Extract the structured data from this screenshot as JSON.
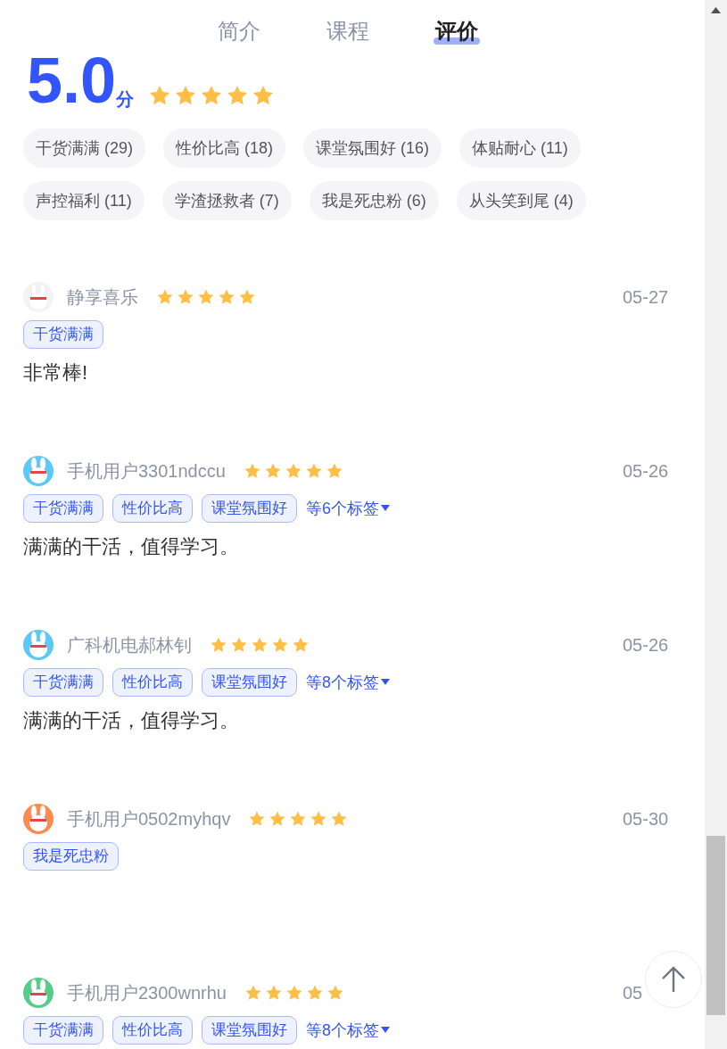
{
  "tabs": [
    {
      "label": "简介",
      "selected": false
    },
    {
      "label": "课程",
      "selected": false
    },
    {
      "label": "评价",
      "selected": true
    }
  ],
  "summary": {
    "score": "5.0",
    "unit": "分",
    "stars": 5
  },
  "tag_filters": [
    {
      "label": "干货满满 (29)"
    },
    {
      "label": "性价比高 (18)"
    },
    {
      "label": "课堂氛围好 (16)"
    },
    {
      "label": "体贴耐心 (11)"
    },
    {
      "label": "声控福利 (11)"
    },
    {
      "label": "学渣拯救者 (7)"
    },
    {
      "label": "我是死忠粉 (6)"
    },
    {
      "label": "从头笑到尾 (4)"
    }
  ],
  "reviews": [
    {
      "user": "静享喜乐",
      "stars": 5,
      "date": "05-27",
      "tags": [
        "干货满满"
      ],
      "comment": "非常棒!"
    },
    {
      "user": "手机用户3301ndccu",
      "stars": 5,
      "date": "05-26",
      "tags": [
        "干货满满",
        "性价比高",
        "课堂氛围好"
      ],
      "more_tags": "等6个标签",
      "comment": "满满的干活，值得学习。"
    },
    {
      "user": "广科机电郝林钊",
      "stars": 5,
      "date": "05-26",
      "tags": [
        "干货满满",
        "性价比高",
        "课堂氛围好"
      ],
      "more_tags": "等8个标签",
      "comment": "满满的干活，值得学习。"
    },
    {
      "user": "手机用户0502myhqv",
      "stars": 5,
      "date": "05-30",
      "tags": [
        "我是死忠粉"
      ]
    },
    {
      "user": "手机用户2300wnrhu",
      "stars": 5,
      "date": "05",
      "tags": [
        "干货满满",
        "性价比高",
        "课堂氛围好"
      ],
      "more_tags": "等8个标签"
    }
  ]
}
